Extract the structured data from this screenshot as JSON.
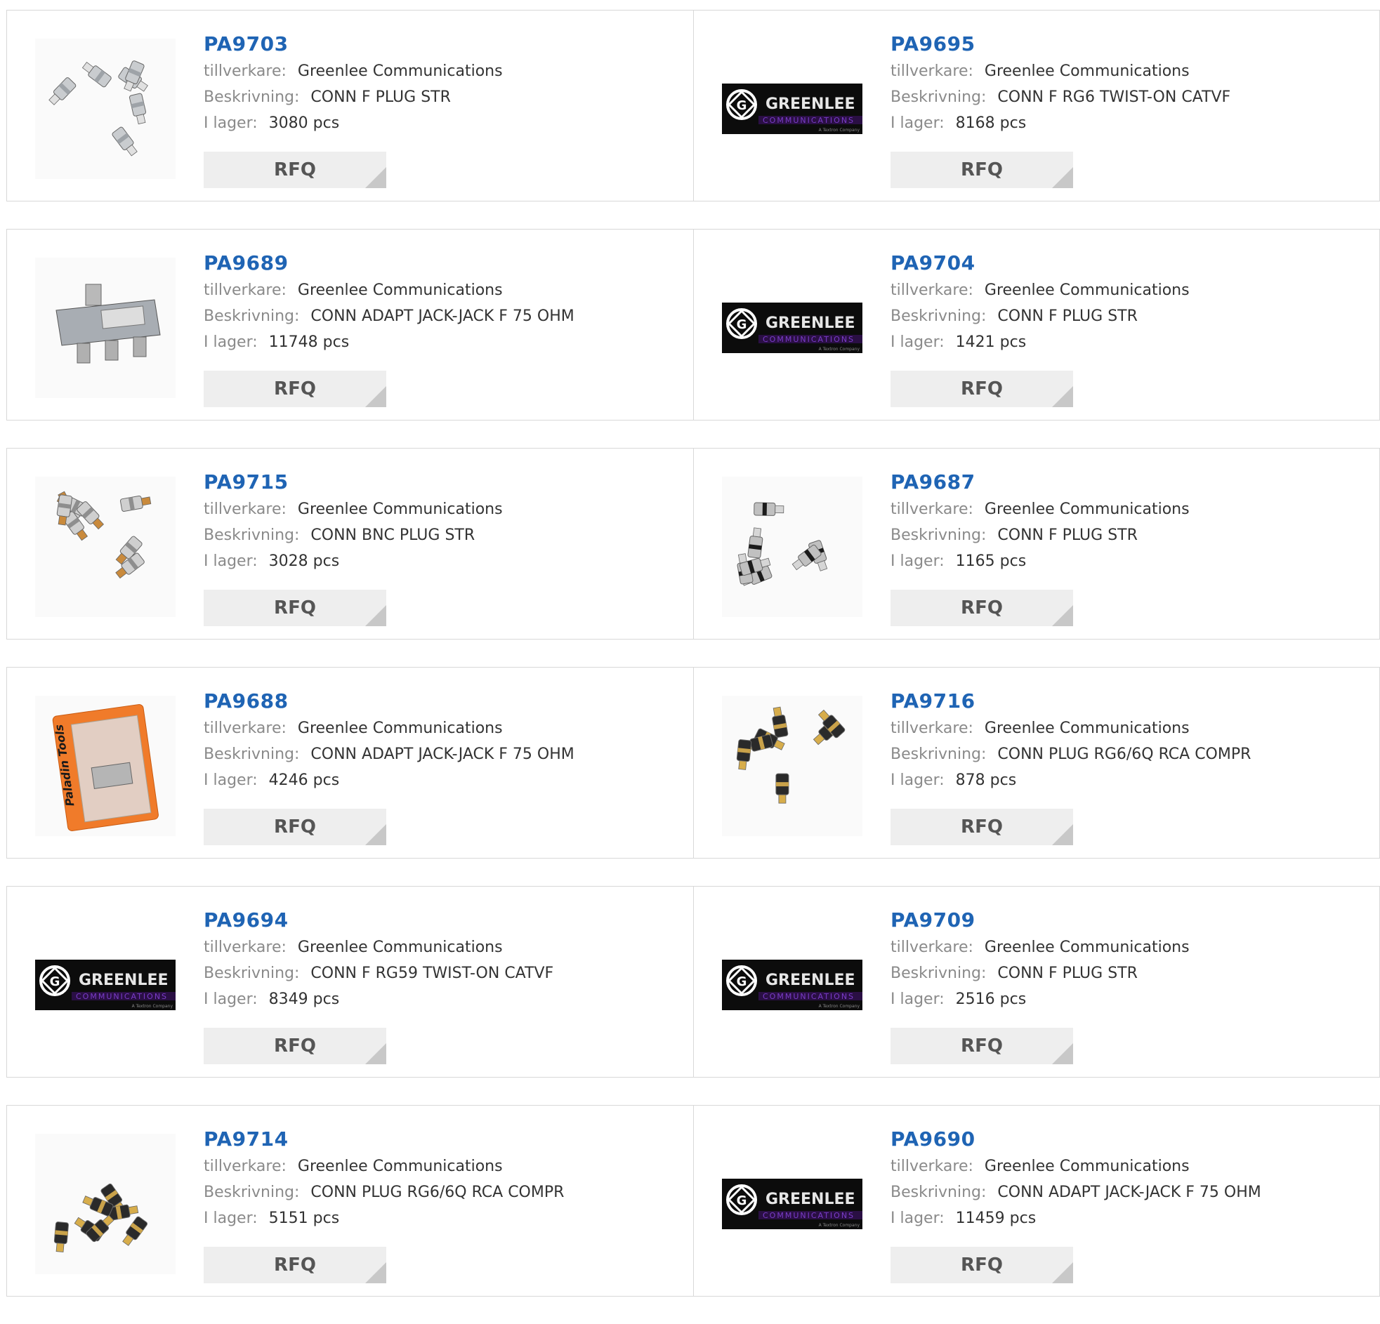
{
  "labels": {
    "manufacturer": "tillverkare:",
    "description": "Beskrivning:",
    "stock": "I lager:",
    "rfq": "RFQ"
  },
  "colors": {
    "part_link": "#1f64b4",
    "label": "#8a8a8a",
    "rfq_bg": "#eeeeee",
    "greenlee_purple": "#7a3cc8"
  },
  "logo": {
    "brand": "GREENLEE",
    "sub": "COMMUNICATIONS",
    "tag": "A Textron Company"
  },
  "products": [
    {
      "part": "PA9703",
      "manufacturer": "Greenlee Communications",
      "description": "CONN F PLUG STR",
      "stock": "3080 pcs",
      "image": "f-connectors-silver-photo"
    },
    {
      "part": "PA9695",
      "manufacturer": "Greenlee Communications",
      "description": "CONN F RG6 TWIST-ON CATVF",
      "stock": "8168 pcs",
      "image": "greenlee-logo"
    },
    {
      "part": "PA9689",
      "manufacturer": "Greenlee Communications",
      "description": "CONN ADAPT JACK-JACK F 75 OHM",
      "stock": "11748 pcs",
      "image": "splitter-photo"
    },
    {
      "part": "PA9704",
      "manufacturer": "Greenlee Communications",
      "description": "CONN F PLUG STR",
      "stock": "1421 pcs",
      "image": "greenlee-logo"
    },
    {
      "part": "PA9715",
      "manufacturer": "Greenlee Communications",
      "description": "CONN BNC PLUG STR",
      "stock": "3028 pcs",
      "image": "bnc-connectors-photo"
    },
    {
      "part": "PA9687",
      "manufacturer": "Greenlee Communications",
      "description": "CONN F PLUG STR",
      "stock": "1165 pcs",
      "image": "f-connectors-black-photo"
    },
    {
      "part": "PA9688",
      "manufacturer": "Greenlee Communications",
      "description": "CONN ADAPT JACK-JACK F 75 OHM",
      "stock": "4246 pcs",
      "image": "paladin-package-photo"
    },
    {
      "part": "PA9716",
      "manufacturer": "Greenlee Communications",
      "description": "CONN PLUG RG6/6Q RCA COMPR",
      "stock": "878 pcs",
      "image": "rca-connectors-photo"
    },
    {
      "part": "PA9694",
      "manufacturer": "Greenlee Communications",
      "description": "CONN F RG59 TWIST-ON CATVF",
      "stock": "8349 pcs",
      "image": "greenlee-logo"
    },
    {
      "part": "PA9709",
      "manufacturer": "Greenlee Communications",
      "description": "CONN F PLUG STR",
      "stock": "2516 pcs",
      "image": "greenlee-logo"
    },
    {
      "part": "PA9714",
      "manufacturer": "Greenlee Communications",
      "description": "CONN PLUG RG6/6Q RCA COMPR",
      "stock": "5151 pcs",
      "image": "rca-connectors-photo"
    },
    {
      "part": "PA9690",
      "manufacturer": "Greenlee Communications",
      "description": "CONN ADAPT JACK-JACK F 75 OHM",
      "stock": "11459 pcs",
      "image": "greenlee-logo"
    }
  ]
}
